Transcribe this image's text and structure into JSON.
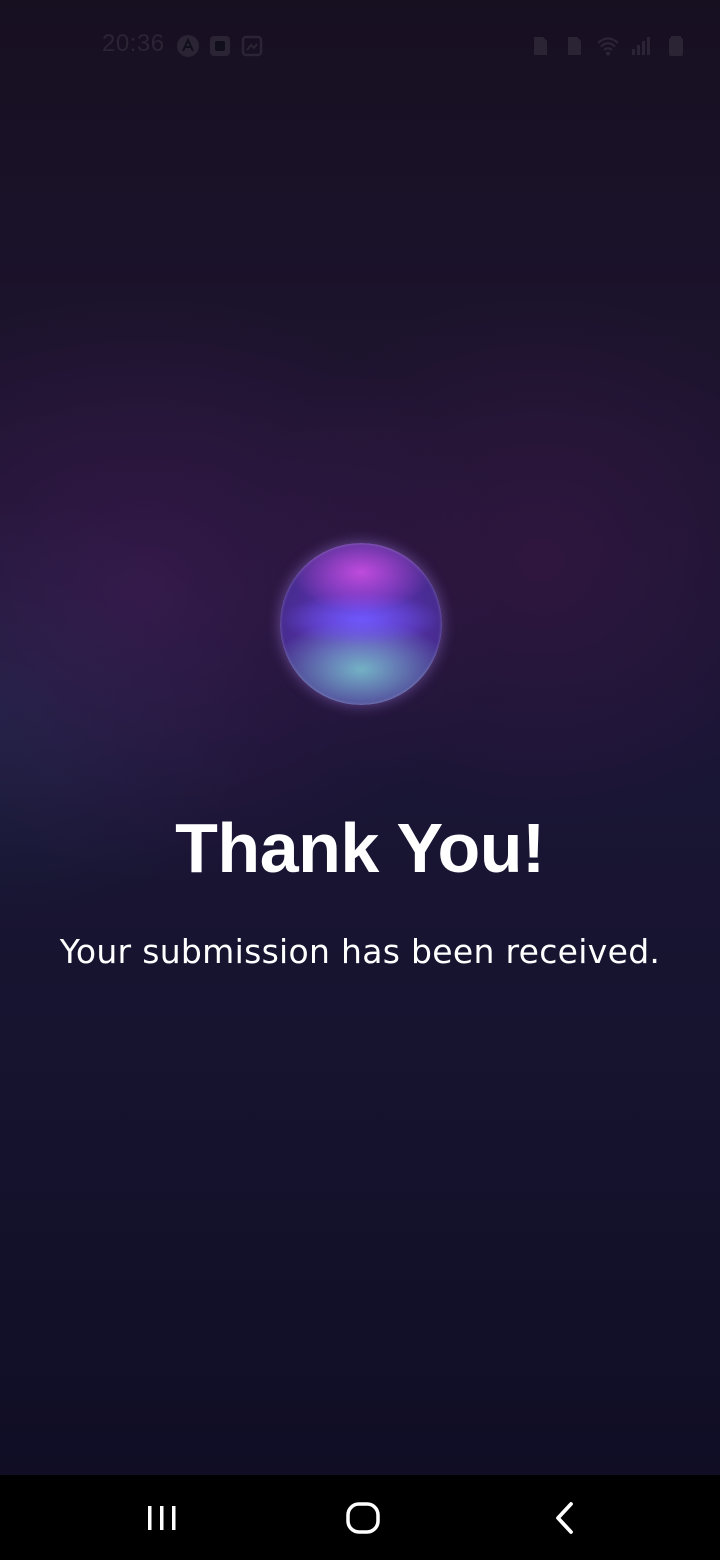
{
  "status_bar": {
    "time": "20:36",
    "left_icons": [
      "app-notification-icon",
      "screen-record-icon",
      "gallery-icon"
    ],
    "right_icons": [
      "sim-icon",
      "sim-icon",
      "wifi-icon",
      "signal-icon",
      "battery-icon"
    ],
    "icon_color": "#2a2434"
  },
  "main": {
    "orb": "gradient-orb",
    "title": "Thank You!",
    "message": "Your submission has been received."
  },
  "nav_bar": {
    "buttons": [
      "recents",
      "home",
      "back"
    ]
  },
  "colors": {
    "background_top": "#171021",
    "background_bottom": "#100d25",
    "text": "#ffffff",
    "orb_purple": "#6b3ad0",
    "orb_teal": "#78c8c8"
  }
}
